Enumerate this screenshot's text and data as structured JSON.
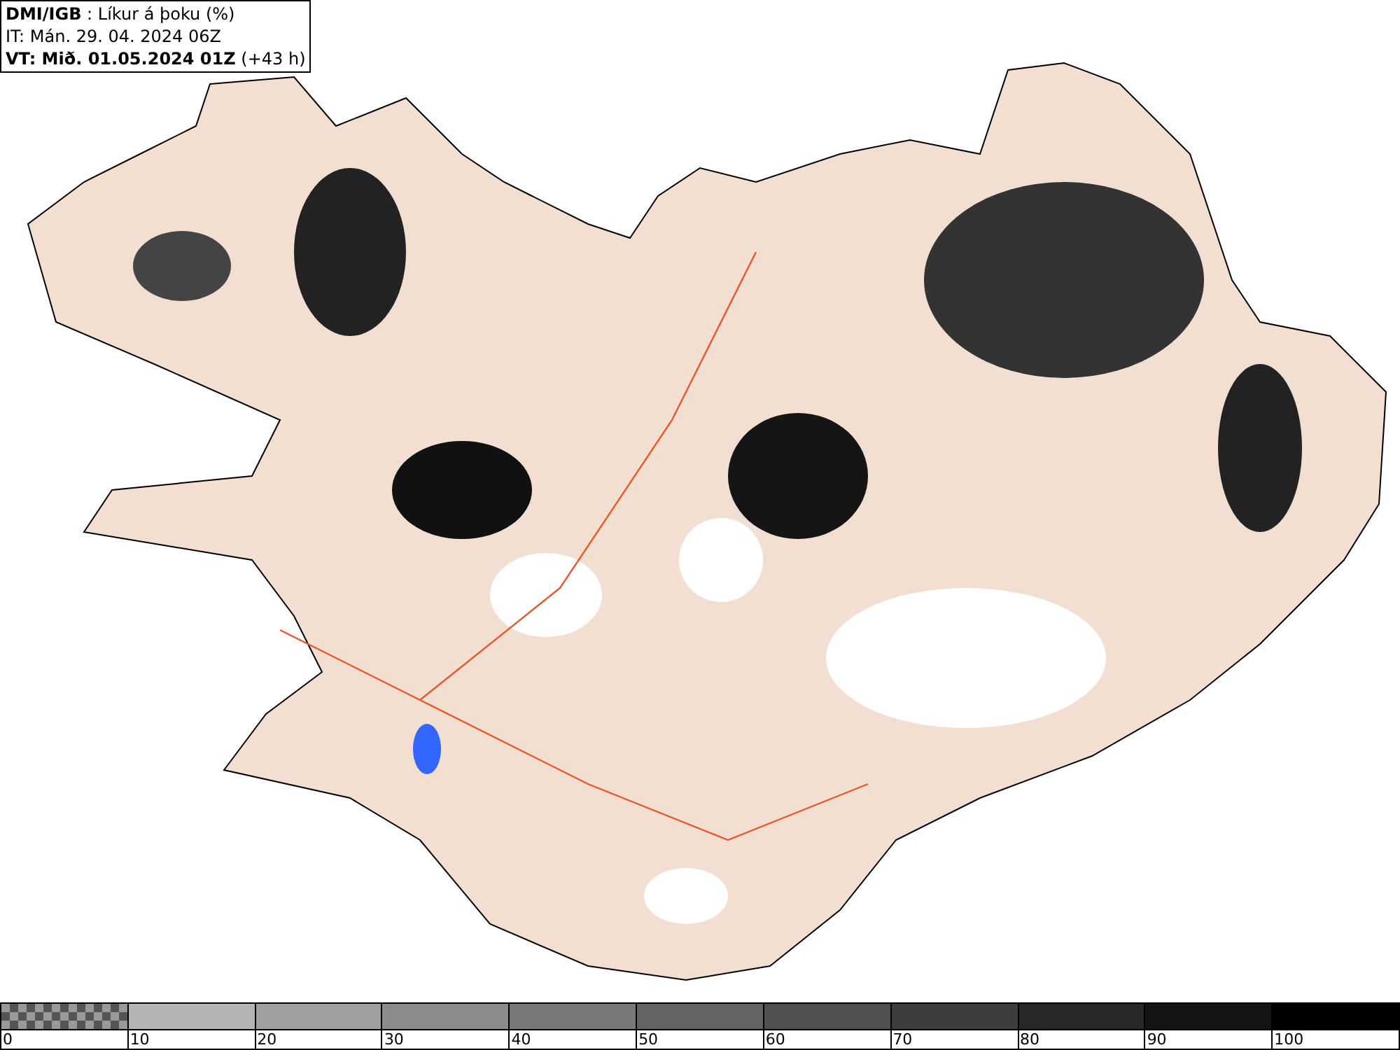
{
  "header": {
    "lines": [
      "**DMI/IGB** : Líkur á þoku (%)",
      "IT: Mán. 29. 04. 2024 06Z",
      "**VT: Mið. 01.05.2024 01Z** (+43 h)"
    ]
  },
  "legend": {
    "labels": [
      "0",
      "10",
      "20",
      "30",
      "40",
      "50",
      "60",
      "70",
      "80",
      "90",
      "100"
    ]
  }
}
